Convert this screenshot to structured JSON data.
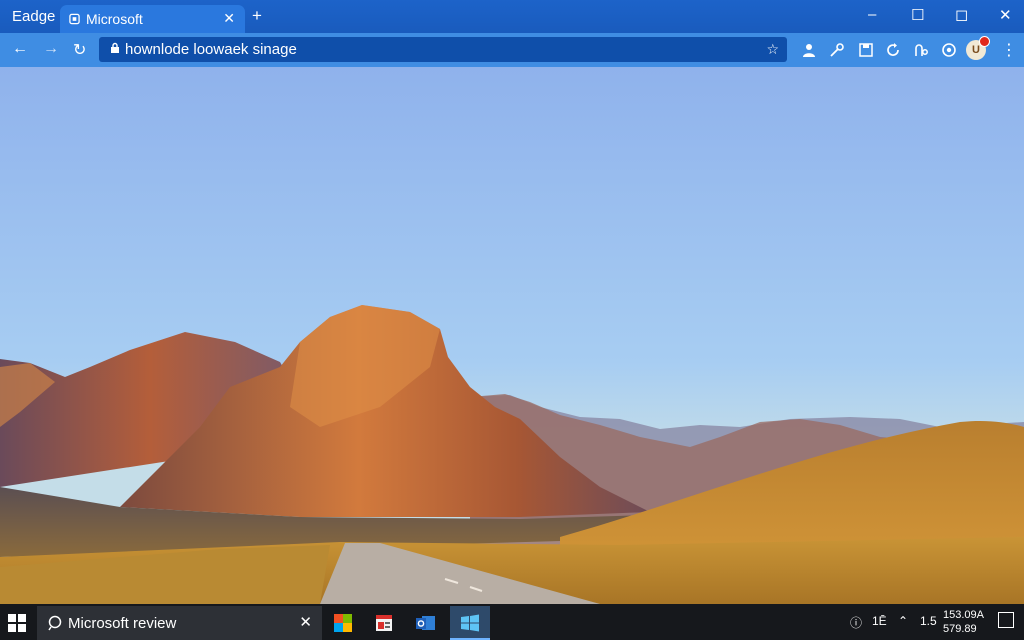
{
  "browser": {
    "brand": "Eadge",
    "tab": {
      "title": "Microsoft",
      "close": "✕"
    },
    "new_tab": "+",
    "window_controls": {
      "minimize": "–",
      "maximize": "☐",
      "close": "✕"
    },
    "nav": {
      "back": "←",
      "forward": "→",
      "refresh": "↻"
    },
    "address_bar": {
      "url": "hownlode loowaek sinage"
    },
    "toolbar_icons": [
      "person-icon",
      "key-icon",
      "save-icon",
      "refresh-icon",
      "accessibility-icon",
      "settings-icon"
    ],
    "profile": {
      "initial": "U",
      "badge": true
    },
    "more": "⋮",
    "accent": "#1d63c9"
  },
  "content": {
    "scene": "desert mountains with road at sunset"
  },
  "taskbar": {
    "search": {
      "text": "Microsoft review",
      "close": "✕"
    },
    "apps": [
      "colorful-app-icon",
      "news-app-icon",
      "outlook-icon",
      "windows-store-icon"
    ],
    "tray": {
      "item1": "ⓘ",
      "item2": "1Ē",
      "item3": "⌃",
      "item4": "1.5"
    },
    "clock": {
      "time": "153.09A",
      "date": "579.89"
    }
  }
}
